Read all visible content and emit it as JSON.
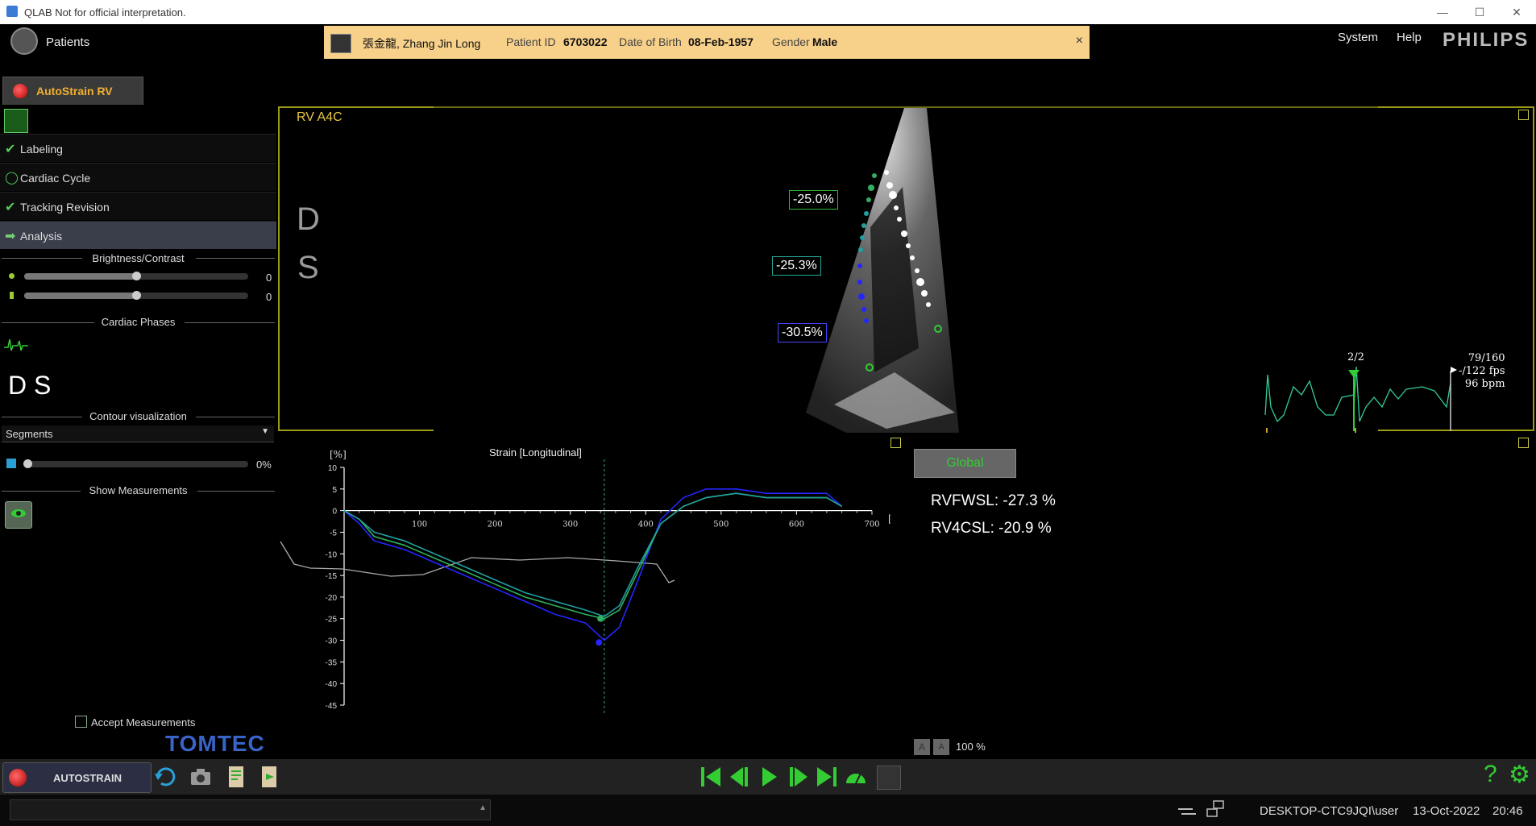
{
  "window": {
    "title": "QLAB Not for official interpretation."
  },
  "header": {
    "patients_label": "Patients",
    "patient": {
      "name": "張金龍, Zhang Jin Long",
      "id_label": "Patient ID",
      "id_value": "6703022",
      "dob_label": "Date of Birth",
      "dob_value": "08-Feb-1957",
      "gender_label": "Gender",
      "gender_value": "Male",
      "close_glyph": "×"
    },
    "menu_system": "System",
    "menu_help": "Help",
    "brand": "PHILIPS"
  },
  "app_tab": {
    "label": "AutoStrain RV"
  },
  "workflow": {
    "steps": [
      {
        "label": "Labeling",
        "status": "done"
      },
      {
        "label": "Cardiac Cycle",
        "status": "pending"
      },
      {
        "label": "Tracking Revision",
        "status": "done"
      },
      {
        "label": "Analysis",
        "status": "active"
      }
    ]
  },
  "brightness_contrast": {
    "title": "Brightness/Contrast",
    "brightness_value": "0",
    "contrast_value": "0",
    "brightness_level": 0.5,
    "contrast_level": 0.5
  },
  "cardiac_phases": {
    "title": "Cardiac Phases",
    "letters": "D S"
  },
  "contour": {
    "title": "Contour visualization",
    "selected": "Segments",
    "opacity_value": "0%"
  },
  "show_measurements": {
    "title": "Show Measurements"
  },
  "accept_measurements": {
    "label": "Accept Measurements",
    "checked": false
  },
  "tomtec_logo": "TOMTEC",
  "image_view": {
    "title": "RV A4C",
    "letter_d": "D",
    "letter_s": "S",
    "strain_labels": [
      "-25.0%",
      "-25.3%",
      "-30.5%"
    ],
    "frame_counter": "2/2",
    "ecg_info": [
      "79/160",
      "-/122 fps",
      "96 bpm"
    ]
  },
  "global_button": "Global",
  "measurements": [
    "RVFWSL: -27.3 %",
    "RV4CSL: -20.9 %"
  ],
  "zoom": {
    "a_large": "A",
    "a_small": "A",
    "value": "100 %"
  },
  "toolbar": {
    "autostrain_label": "AUTOSTRAIN",
    "help_glyph": "?",
    "settings_glyph": "⚙"
  },
  "status": {
    "user": "DESKTOP-CTC9JQI\\user",
    "date": "13-Oct-2022",
    "time": "20:46"
  },
  "chart_data": {
    "type": "line",
    "title": "Strain [Longitudinal]",
    "ylabel": "[%]",
    "xlabel": "[ms]",
    "xlim": [
      0,
      700
    ],
    "ylim": [
      -45,
      10
    ],
    "xticks": [
      100,
      200,
      300,
      400,
      500,
      600,
      700
    ],
    "yticks": [
      10,
      5,
      0,
      -5,
      -10,
      -15,
      -20,
      -25,
      -30,
      -35,
      -40,
      -45
    ],
    "marker_x": 345,
    "series": [
      {
        "color": "#2525ff",
        "x": [
          0,
          20,
          40,
          80,
          120,
          160,
          200,
          240,
          280,
          320,
          345,
          365,
          390,
          420,
          450,
          480,
          520,
          560,
          600,
          640,
          660
        ],
        "y": [
          0,
          -3,
          -7,
          -9,
          -12,
          -15,
          -18,
          -21,
          -24,
          -26,
          -30,
          -27,
          -16,
          -2,
          3,
          5,
          5,
          4,
          4,
          4,
          1
        ]
      },
      {
        "color": "#30b060",
        "x": [
          0,
          20,
          40,
          80,
          120,
          160,
          200,
          240,
          280,
          320,
          345,
          365,
          390,
          420,
          450,
          480,
          520,
          560,
          600,
          640,
          660
        ],
        "y": [
          0,
          -2,
          -6,
          -8,
          -11,
          -14,
          -17,
          -20,
          -22,
          -24,
          -25,
          -23,
          -14,
          -3,
          1,
          3,
          4,
          3,
          3,
          3,
          1
        ]
      },
      {
        "color": "#20a0a0",
        "x": [
          0,
          20,
          40,
          80,
          120,
          160,
          200,
          240,
          280,
          320,
          345,
          365,
          390,
          420,
          450,
          480,
          520,
          560,
          600,
          640,
          660
        ],
        "y": [
          0,
          -2,
          -5,
          -7,
          -10,
          -13,
          -16,
          -19,
          -21,
          -23,
          -24.5,
          -22,
          -13,
          -3,
          1,
          3,
          4,
          3,
          3,
          3,
          1
        ]
      }
    ],
    "points": [
      {
        "x": 340,
        "y": -25,
        "color": "#30b060"
      },
      {
        "x": 338,
        "y": -30.5,
        "color": "#2525ff"
      }
    ]
  }
}
